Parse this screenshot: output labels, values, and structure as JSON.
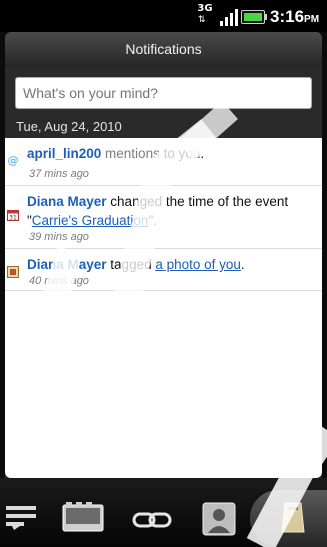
{
  "status_bar": {
    "network": "3G",
    "time": "3:16",
    "ampm": "PM",
    "battery_color": "#49d649"
  },
  "header": {
    "title": "Notifications"
  },
  "status_input": {
    "placeholder": "What's on your mind?"
  },
  "date_header": "Tue, Aug 24, 2010",
  "notifications": [
    {
      "icon": "mention-at-icon",
      "name": "april_lin200",
      "text_before": " mentions",
      "text_after": " to you.",
      "time": "37 mins ago"
    },
    {
      "icon": "calendar-icon",
      "name": "Diana Mayer",
      "text_before": " changed the time of the event \"",
      "link": "Carrie's Graduation",
      "text_after": "\".",
      "time": "39 mins ago"
    },
    {
      "icon": "photo-icon",
      "name": "Diana Mayer",
      "text_before": " tagged ",
      "link": "a photo of you",
      "text_after": ".",
      "time": "40 mins ago"
    }
  ],
  "tabs": [
    {
      "icon": "status-updates-icon"
    },
    {
      "icon": "photos-icon"
    },
    {
      "icon": "links-icon"
    },
    {
      "icon": "friends-icon"
    },
    {
      "icon": "notifications-icon",
      "active": true
    }
  ]
}
